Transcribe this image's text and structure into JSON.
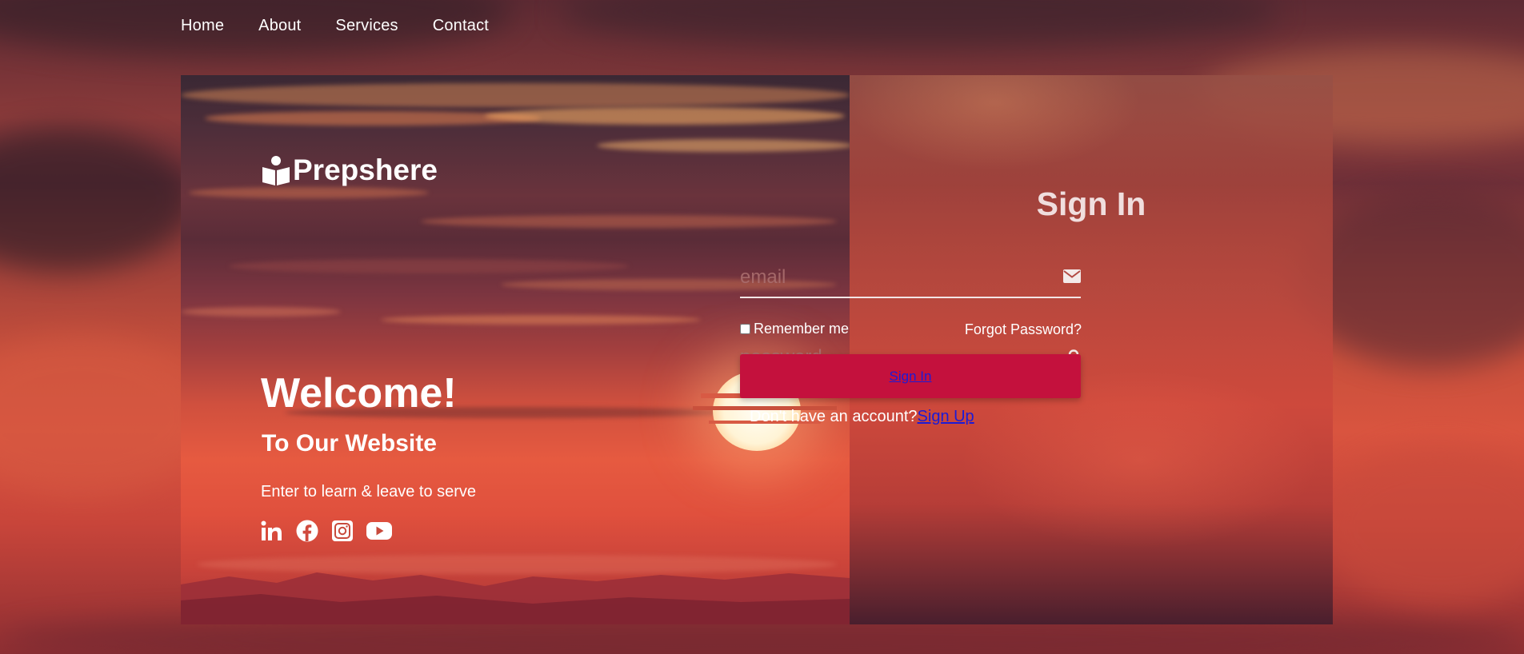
{
  "nav": {
    "items": [
      {
        "label": "Home"
      },
      {
        "label": "About"
      },
      {
        "label": "Services"
      },
      {
        "label": "Contact"
      }
    ]
  },
  "brand": {
    "name": "Prepshere",
    "icon": "reader-book-icon"
  },
  "hero": {
    "title": "Welcome!",
    "subtitle": "To Our Website",
    "tagline": "Enter to learn & leave to serve"
  },
  "socials": [
    {
      "icon": "linkedin-icon"
    },
    {
      "icon": "facebook-icon"
    },
    {
      "icon": "instagram-icon"
    },
    {
      "icon": "youtube-icon"
    }
  ],
  "signin": {
    "title": "Sign In",
    "email_placeholder": "email",
    "email_value": "",
    "password_placeholder": "password",
    "password_value": "",
    "remember_label": "Remember me",
    "remember_checked": false,
    "forgot_label": "Forgot Password?",
    "submit_label": "Sign In",
    "no_account_text": "Don't have an account?",
    "signup_link": "Sign Up"
  },
  "colors": {
    "accent": "#c4113d",
    "link": "#1b1bd6",
    "text": "#ffffff"
  }
}
